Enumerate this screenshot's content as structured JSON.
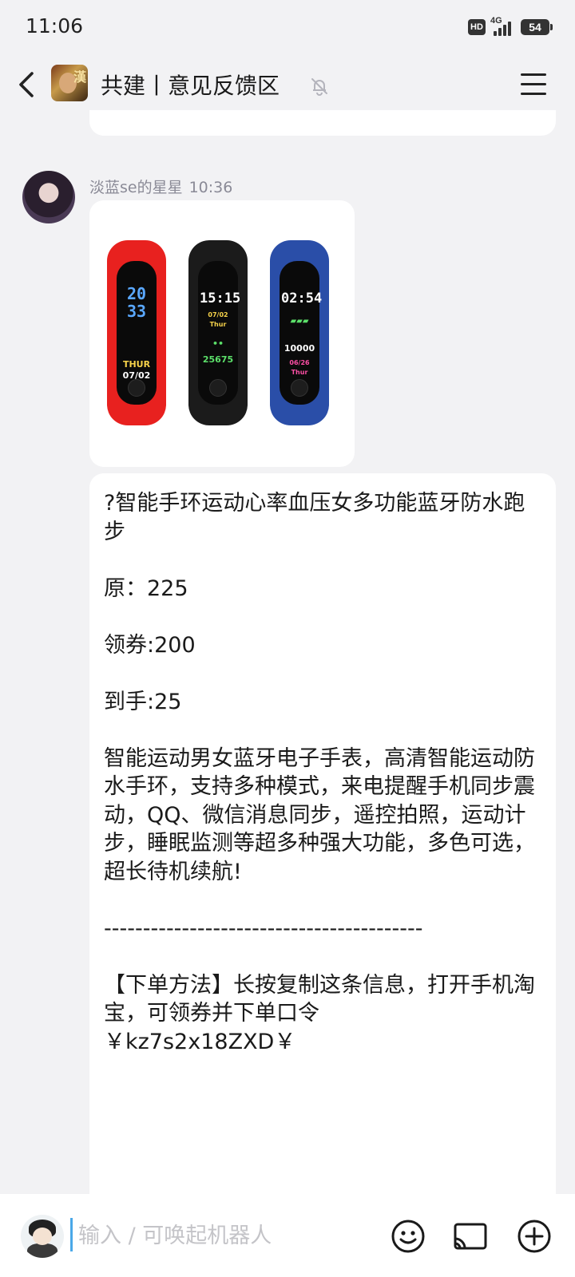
{
  "status_bar": {
    "time": "11:06",
    "hd_label": "HD",
    "network": "4G",
    "battery": "54"
  },
  "header": {
    "title": "共建丨意见反馈区",
    "avatar_char": "漢",
    "back_icon": "chevron-left-icon",
    "mute_icon": "bell-off-icon",
    "menu_icon": "hamburger-menu-icon"
  },
  "message": {
    "sender": "淡蓝se的星星",
    "time": "10:36",
    "image": {
      "bands": [
        {
          "color": "#e8211f",
          "line1": "20\n33",
          "line2": "",
          "line3": "THUR",
          "line4": "07/02",
          "accent": "#4aa0ff"
        },
        {
          "color": "#1b1b1b",
          "line1": "15:15",
          "line2": "07/02 Thur",
          "line3": "•••",
          "line4": "25675",
          "accent": "#f6d24a"
        },
        {
          "color": "#2a4ea8",
          "line1": "02:54",
          "line2": "━━━━",
          "line3": "10000",
          "line4": "06/26 Thur",
          "accent": "#ff4fa6"
        }
      ]
    },
    "text": "?智能手环运动心率血压女多功能蓝牙防水跑步\n\n原：225\n\n领券:200\n\n到手:25\n\n智能运动男女蓝牙电子手表，高清智能运动防水手环，支持多种模式，来电提醒手机同步震动，QQ、微信消息同步，遥控拍照，运动计步，睡眠监测等超多种强大功能，多色可选，超长待机续航!\n\n-----------------------------------------\n\n【下单方法】长按复制这条信息，打开手机淘宝，可领券并下单口令\n￥kz7s2x18ZXD￥"
  },
  "input_bar": {
    "placeholder": "输入 / 可唤起机器人",
    "emoji_icon": "smiley-icon",
    "cast_icon": "screen-cast-icon",
    "add_icon": "plus-circle-icon"
  },
  "colors": {
    "background": "#f2f2f4",
    "bubble": "#ffffff",
    "muted_text": "#8a8a96",
    "caret": "#4aa8e8"
  }
}
